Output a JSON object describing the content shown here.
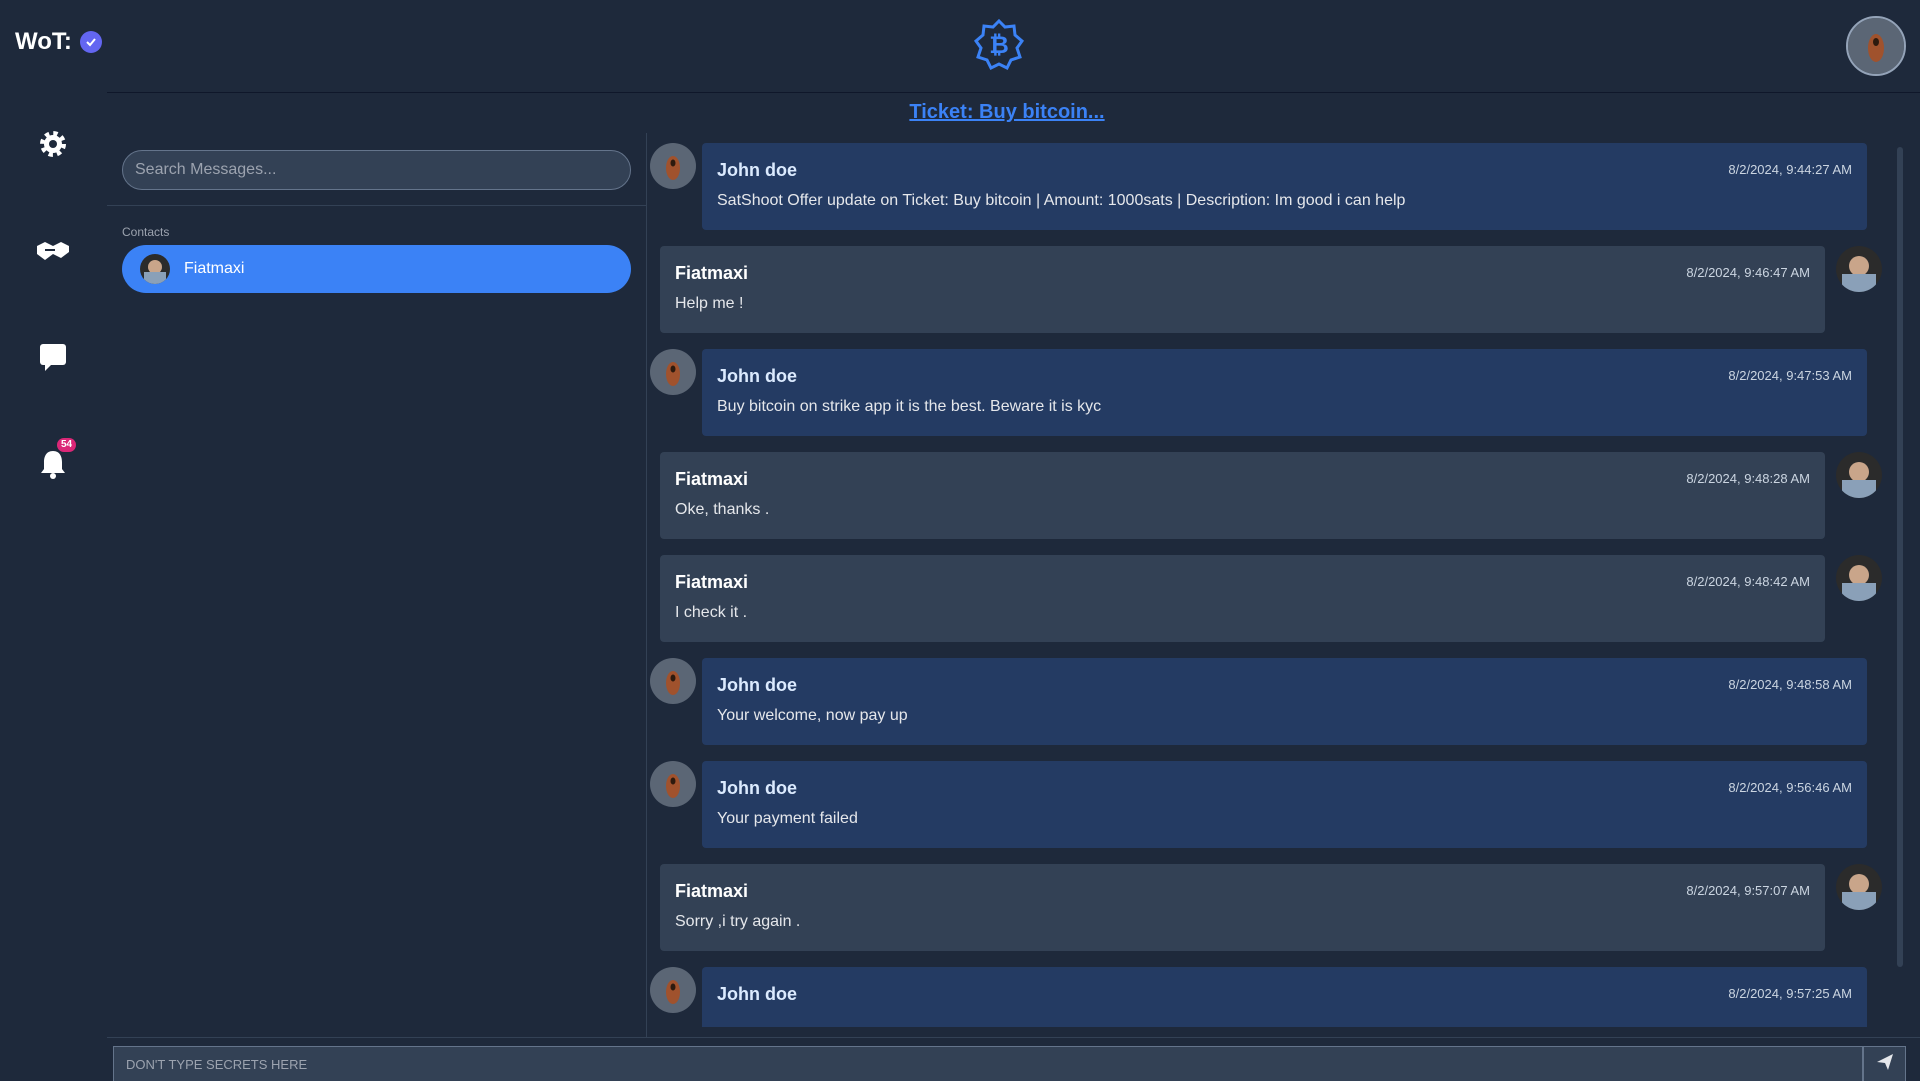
{
  "header": {
    "wot_label": "WoT:"
  },
  "sidebar": {
    "notification_count": "54"
  },
  "ticket": {
    "title": "Ticket: Buy bitcoin..."
  },
  "search": {
    "placeholder": "Search Messages..."
  },
  "contacts": {
    "label": "Contacts",
    "items": [
      {
        "name": "Fiatmaxi"
      }
    ]
  },
  "messages": [
    {
      "sender": "John doe",
      "side": "me",
      "time": "8/2/2024, 9:44:27 AM",
      "text": "SatShoot Offer update on Ticket: Buy bitcoin | Amount: 1000sats | Description: Im good i can help"
    },
    {
      "sender": "Fiatmaxi",
      "side": "them",
      "time": "8/2/2024, 9:46:47 AM",
      "text": "Help me !"
    },
    {
      "sender": "John doe",
      "side": "me",
      "time": "8/2/2024, 9:47:53 AM",
      "text": "Buy bitcoin on strike app it is the best. Beware it is kyc"
    },
    {
      "sender": "Fiatmaxi",
      "side": "them",
      "time": "8/2/2024, 9:48:28 AM",
      "text": "Oke, thanks ."
    },
    {
      "sender": "Fiatmaxi",
      "side": "them",
      "time": "8/2/2024, 9:48:42 AM",
      "text": "I check it ."
    },
    {
      "sender": "John doe",
      "side": "me",
      "time": "8/2/2024, 9:48:58 AM",
      "text": "Your welcome, now pay up"
    },
    {
      "sender": "John doe",
      "side": "me",
      "time": "8/2/2024, 9:56:46 AM",
      "text": "Your payment failed"
    },
    {
      "sender": "Fiatmaxi",
      "side": "them",
      "time": "8/2/2024, 9:57:07 AM",
      "text": "Sorry ,i try again ."
    },
    {
      "sender": "John doe",
      "side": "me",
      "time": "8/2/2024, 9:57:25 AM",
      "text": ""
    }
  ],
  "composer": {
    "placeholder": "DON'T TYPE SECRETS HERE"
  },
  "colors": {
    "accent": "#3b82f6",
    "verified": "#6366f1",
    "badge": "#db2777"
  }
}
